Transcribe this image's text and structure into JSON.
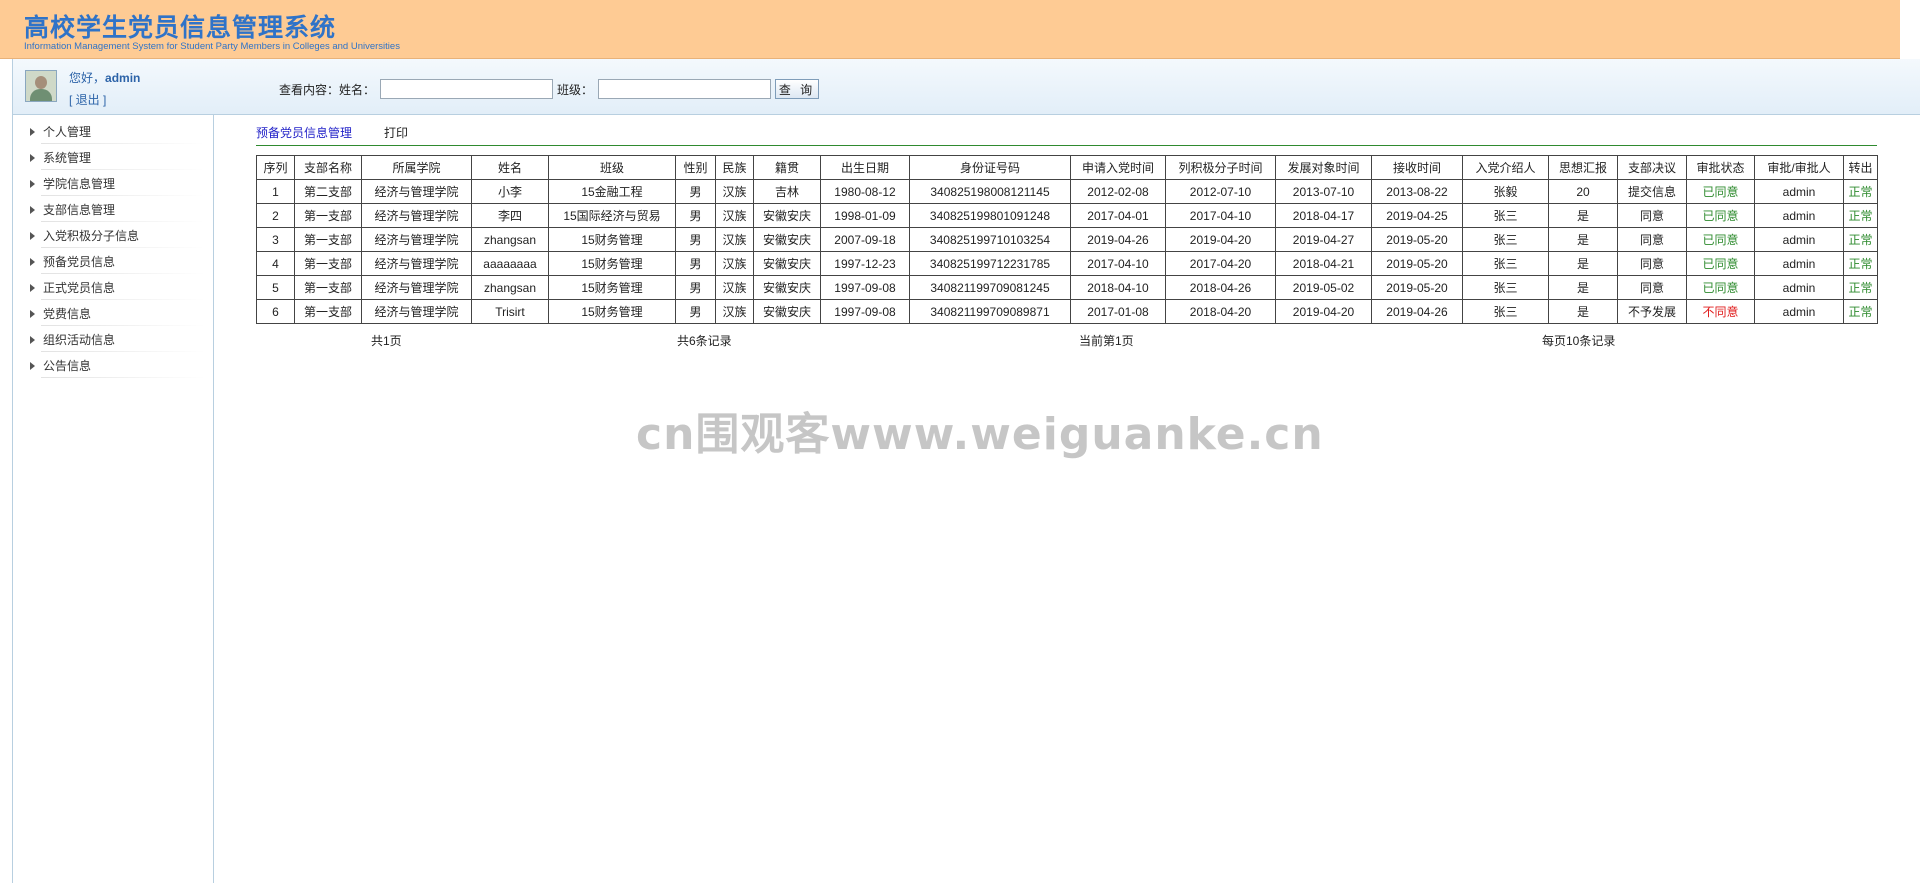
{
  "header": {
    "title": "高校学生党员信息管理系统",
    "subtitle": "Information Management System for Student Party Members in Colleges and Universities",
    "bg_color": "#fecb94",
    "title_color": "#2f73c8"
  },
  "user": {
    "greeting": "您好，",
    "username": "admin",
    "logout": "[ 退出 ]"
  },
  "sidebar": {
    "items": [
      {
        "label": "个人管理"
      },
      {
        "label": "系统管理"
      },
      {
        "label": "学院信息管理"
      },
      {
        "label": "支部信息管理"
      },
      {
        "label": "入党积极分子信息"
      },
      {
        "label": "预备党员信息"
      },
      {
        "label": "正式党员信息"
      },
      {
        "label": "党费信息"
      },
      {
        "label": "组织活动信息"
      },
      {
        "label": "公告信息"
      }
    ]
  },
  "search": {
    "label": "查看内容：姓名：",
    "name_value": "",
    "class_label": "班级：",
    "class_value": "",
    "button": "查 询"
  },
  "tabs": {
    "main": "预备党员信息管理",
    "print": "打印"
  },
  "table": {
    "headers": [
      "序列",
      "支部名称",
      "所属学院",
      "姓名",
      "班级",
      "性别",
      "民族",
      "籍贯",
      "出生日期",
      "身份证号码",
      "申请入党时间",
      "列积极分子时间",
      "发展对象时间",
      "接收时间",
      "入党介绍人",
      "思想汇报",
      "支部决议",
      "审批状态",
      "审批/审批人",
      "转出"
    ],
    "rows": [
      [
        "1",
        "第二支部",
        "经济与管理学院",
        "小李",
        "15金融工程",
        "男",
        "汉族",
        "吉林",
        "1980-08-12",
        "340825198008121145",
        "2012-02-08",
        "2012-07-10",
        "2013-07-10",
        "2013-08-22",
        "张毅",
        "20",
        "提交信息",
        "已同意",
        "admin",
        "正常"
      ],
      [
        "2",
        "第一支部",
        "经济与管理学院",
        "李四",
        "15国际经济与贸易",
        "男",
        "汉族",
        "安徽安庆",
        "1998-01-09",
        "340825199801091248",
        "2017-04-01",
        "2017-04-10",
        "2018-04-17",
        "2019-04-25",
        "张三",
        "是",
        "同意",
        "已同意",
        "admin",
        "正常"
      ],
      [
        "3",
        "第一支部",
        "经济与管理学院",
        "zhangsan",
        "15财务管理",
        "男",
        "汉族",
        "安徽安庆",
        "2007-09-18",
        "340825199710103254",
        "2019-04-26",
        "2019-04-20",
        "2019-04-27",
        "2019-05-20",
        "张三",
        "是",
        "同意",
        "已同意",
        "admin",
        "正常"
      ],
      [
        "4",
        "第一支部",
        "经济与管理学院",
        "aaaaaaaa",
        "15财务管理",
        "男",
        "汉族",
        "安徽安庆",
        "1997-12-23",
        "340825199712231785",
        "2017-04-10",
        "2017-04-20",
        "2018-04-21",
        "2019-05-20",
        "张三",
        "是",
        "同意",
        "已同意",
        "admin",
        "正常"
      ],
      [
        "5",
        "第一支部",
        "经济与管理学院",
        "zhangsan",
        "15财务管理",
        "男",
        "汉族",
        "安徽安庆",
        "1997-09-08",
        "340821199709081245",
        "2018-04-10",
        "2018-04-26",
        "2019-05-02",
        "2019-05-20",
        "张三",
        "是",
        "同意",
        "已同意",
        "admin",
        "正常"
      ],
      [
        "6",
        "第一支部",
        "经济与管理学院",
        "Trisirt",
        "15财务管理",
        "男",
        "汉族",
        "安徽安庆",
        "1997-09-08",
        "340821199709089871",
        "2017-01-08",
        "2018-04-20",
        "2019-04-20",
        "2019-04-26",
        "张三",
        "是",
        "不予发展",
        "不同意",
        "admin",
        "正常"
      ]
    ],
    "status_colors": {
      "agree": "#2e8b2e",
      "reject": "#e01b1b"
    }
  },
  "pagination": {
    "total_pages": "共1页",
    "total_records": "共6条记录",
    "current_page": "当前第1页",
    "per_page": "每页10条记录"
  },
  "watermark": "cn围观客www.weiguanke.cn"
}
